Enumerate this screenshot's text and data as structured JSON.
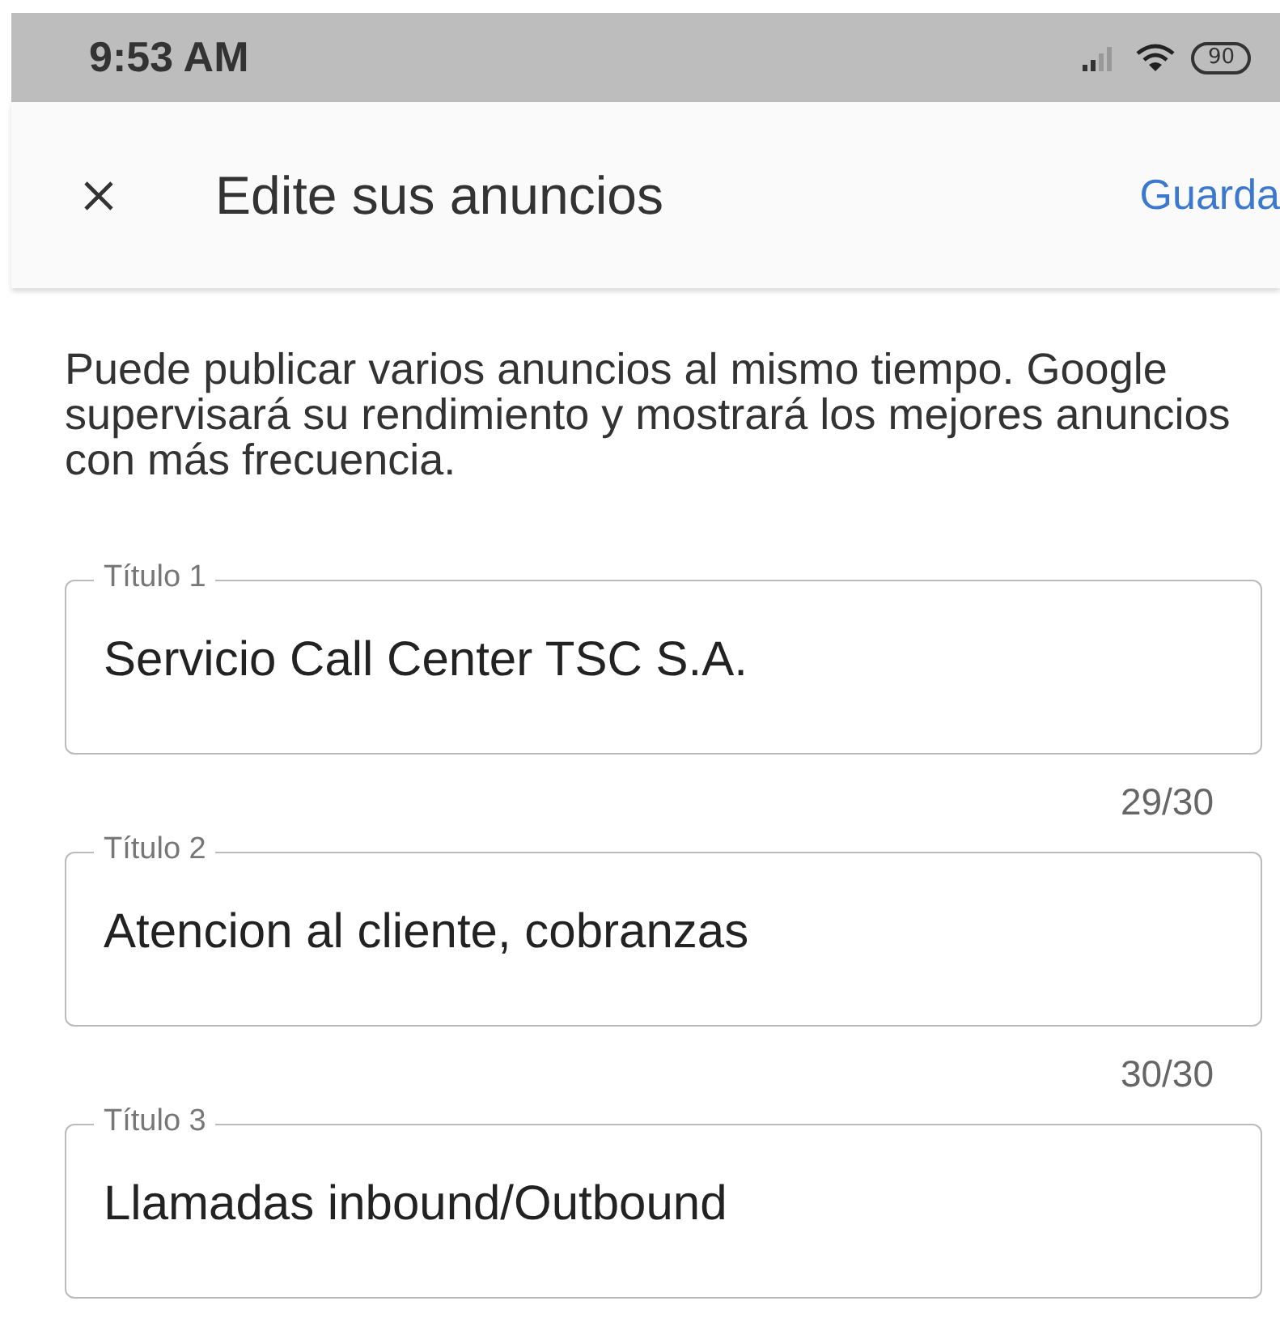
{
  "status_bar": {
    "time": "9:53 AM",
    "battery": "90"
  },
  "header": {
    "title": "Edite sus anuncios",
    "action": "Guarda"
  },
  "intro": "Puede publicar varios anuncios al mismo tiempo. Google supervisará su rendimiento y mostrará los mejores anuncios con más frecuencia.",
  "fields": [
    {
      "label": "Título 1",
      "value": "Servicio Call Center TSC S.A.",
      "counter": "29/30"
    },
    {
      "label": "Título 2",
      "value": "Atencion al cliente, cobranzas",
      "counter": "30/30"
    },
    {
      "label": "Título 3",
      "value": "Llamadas inbound/Outbound"
    }
  ]
}
